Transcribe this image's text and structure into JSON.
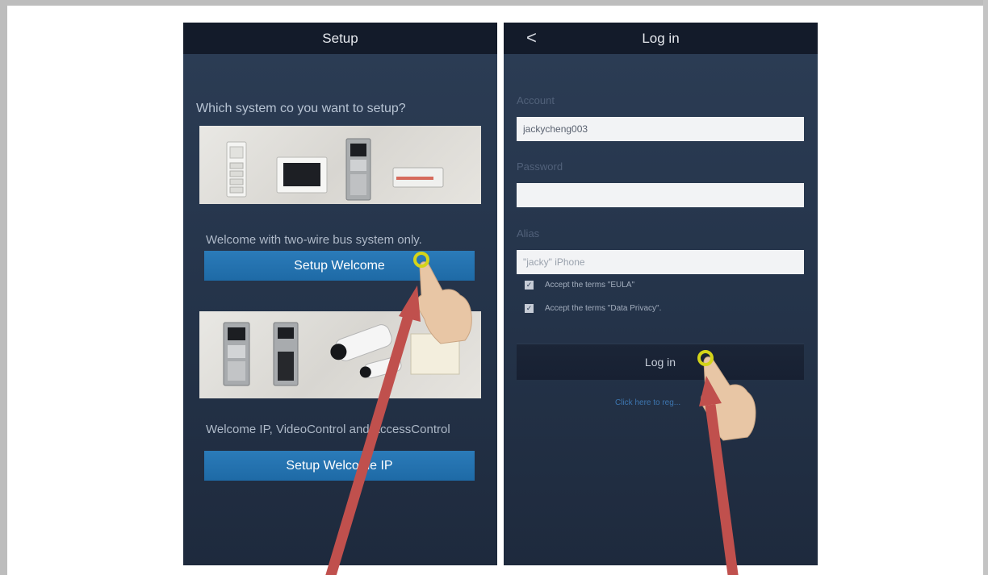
{
  "left_screen": {
    "title": "Setup",
    "question": "Which system co you want to setup?",
    "option1": {
      "caption": "Welcome with two-wire bus system only.",
      "button": "Setup Welcome"
    },
    "option2": {
      "caption": "Welcome IP, VideoControl and AccessControl",
      "button": "Setup Welcome IP"
    }
  },
  "right_screen": {
    "title": "Log in",
    "back_glyph": "<",
    "account_label": "Account",
    "account_value": "jackycheng003",
    "password_label": "Password",
    "password_value": "",
    "alias_label": "Alias",
    "alias_placeholder": "\"jacky\" iPhone",
    "terms": [
      {
        "label": "Accept the terms \"EULA\"",
        "checked": true
      },
      {
        "label": "Accept the terms \"Data Privacy\".",
        "checked": true
      }
    ],
    "login_button": "Log in",
    "register_link": "Click here to reg..."
  },
  "icons": [
    "back-chevron-icon",
    "checkbox-checked-icon",
    "pointing-hand-icon",
    "annotation-arrow-icon",
    "tap-indicator-icon"
  ],
  "colors": {
    "nav_bar": "#131b2a",
    "screen_bg": "#243349",
    "primary_button": "#2b7bb9",
    "link": "#3d76b0",
    "arrow": "#c0504d",
    "tap_ring": "#d4d419"
  }
}
